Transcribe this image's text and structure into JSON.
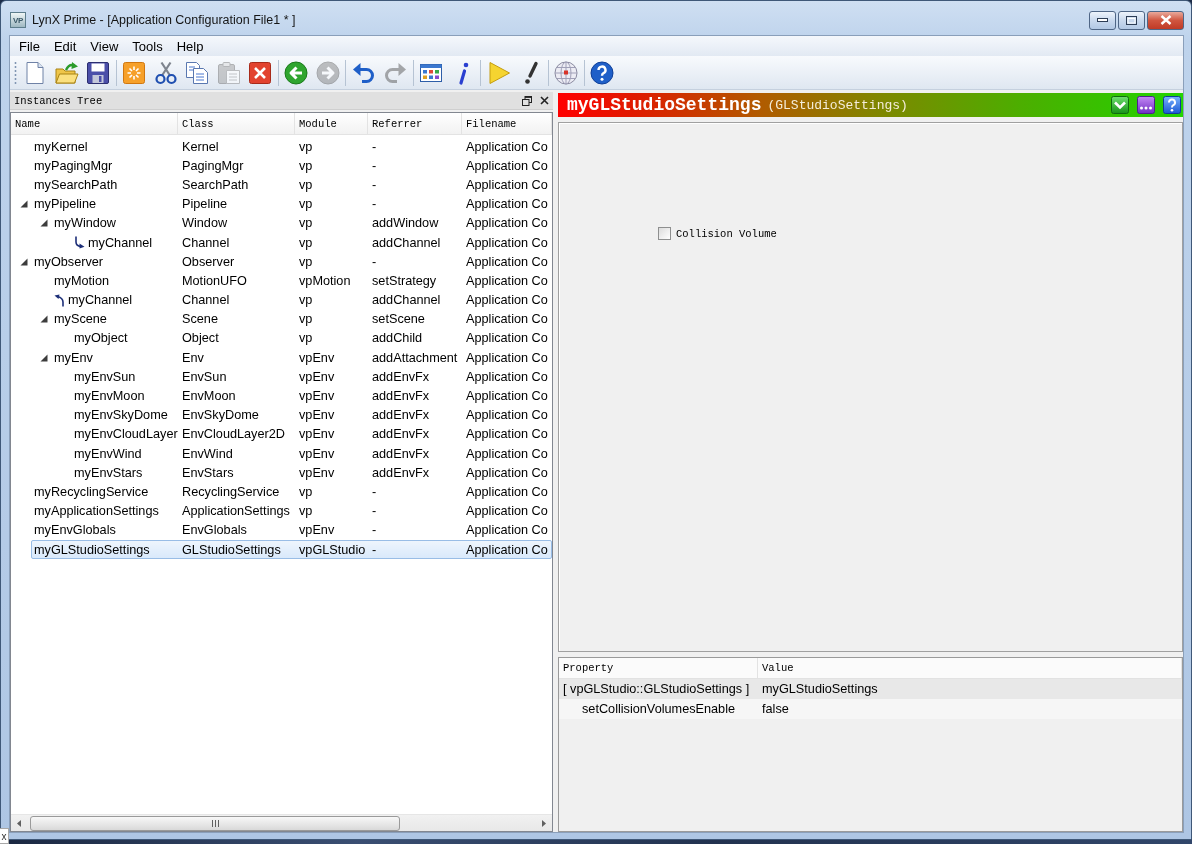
{
  "window": {
    "icon_text": "VP",
    "title": "LynX Prime - [Application Configuration File1 * ]"
  },
  "menu": [
    "File",
    "Edit",
    "View",
    "Tools",
    "Help"
  ],
  "toolbar": {
    "groups": [
      [
        {
          "kind": "new",
          "disabled": false
        },
        {
          "kind": "open",
          "disabled": false
        },
        {
          "kind": "save",
          "disabled": false
        }
      ],
      [
        {
          "kind": "create",
          "disabled": false
        },
        {
          "kind": "cut",
          "disabled": false
        },
        {
          "kind": "copy",
          "disabled": false
        },
        {
          "kind": "paste",
          "disabled": true
        },
        {
          "kind": "delete",
          "disabled": false
        }
      ],
      [
        {
          "kind": "back",
          "disabled": false
        },
        {
          "kind": "forward",
          "disabled": true
        }
      ],
      [
        {
          "kind": "undo",
          "disabled": false
        },
        {
          "kind": "redo",
          "disabled": true
        }
      ],
      [
        {
          "kind": "layout",
          "disabled": false
        },
        {
          "kind": "info",
          "disabled": false
        }
      ],
      [
        {
          "kind": "run",
          "disabled": false
        },
        {
          "kind": "check",
          "disabled": false
        }
      ],
      [
        {
          "kind": "network",
          "disabled": false
        }
      ],
      [
        {
          "kind": "help",
          "disabled": false
        }
      ]
    ]
  },
  "instances_tree": {
    "title": "Instances Tree",
    "columns": [
      "Name",
      "Class",
      "Module",
      "Referrer",
      "Filename"
    ],
    "rows": [
      {
        "kind": "plain",
        "name": "myKernel",
        "class": "Kernel",
        "module": "vp",
        "referrer": "-",
        "filename": "Application Co",
        "selected": false
      },
      {
        "kind": "plain",
        "name": "myPagingMgr",
        "class": "PagingMgr",
        "module": "vp",
        "referrer": "-",
        "filename": "Application Co",
        "selected": false
      },
      {
        "kind": "plain",
        "name": "mySearchPath",
        "class": "SearchPath",
        "module": "vp",
        "referrer": "-",
        "filename": "Application Co",
        "selected": false
      },
      {
        "kind": "plain",
        "name": "myPipeline",
        "class": "Pipeline",
        "module": "vp",
        "referrer": "-",
        "filename": "Application Co",
        "selected": false,
        "expanded": true,
        "children": [
          {
            "kind": "plain",
            "name": "myWindow",
            "class": "Window",
            "module": "vp",
            "referrer": "addWindow",
            "filename": "Application Co",
            "selected": false,
            "expanded": true,
            "children": [
              {
                "kind": "outlink",
                "name": "myChannel",
                "class": "Channel",
                "module": "vp",
                "referrer": "addChannel",
                "filename": "Application Co",
                "selected": false
              }
            ]
          }
        ]
      },
      {
        "kind": "plain",
        "name": "myObserver",
        "class": "Observer",
        "module": "vp",
        "referrer": "-",
        "filename": "Application Co",
        "selected": false,
        "expanded": true,
        "children": [
          {
            "kind": "plain",
            "name": "myMotion",
            "class": "MotionUFO",
            "module": "vpMotion",
            "referrer": "setStrategy",
            "filename": "Application Co",
            "selected": false
          },
          {
            "kind": "inlink",
            "name": "myChannel",
            "class": "Channel",
            "module": "vp",
            "referrer": "addChannel",
            "filename": "Application Co",
            "selected": false
          },
          {
            "kind": "plain",
            "name": "myScene",
            "class": "Scene",
            "module": "vp",
            "referrer": "setScene",
            "filename": "Application Co",
            "selected": false,
            "expanded": true,
            "children": [
              {
                "kind": "plain",
                "name": "myObject",
                "class": "Object",
                "module": "vp",
                "referrer": "addChild",
                "filename": "Application Co",
                "selected": false
              }
            ]
          },
          {
            "kind": "plain",
            "name": "myEnv",
            "class": "Env",
            "module": "vpEnv",
            "referrer": "addAttachment",
            "filename": "Application Co",
            "selected": false,
            "expanded": true,
            "children": [
              {
                "kind": "plain",
                "name": "myEnvSun",
                "class": "EnvSun",
                "module": "vpEnv",
                "referrer": "addEnvFx",
                "filename": "Application Co",
                "selected": false
              },
              {
                "kind": "plain",
                "name": "myEnvMoon",
                "class": "EnvMoon",
                "module": "vpEnv",
                "referrer": "addEnvFx",
                "filename": "Application Co",
                "selected": false
              },
              {
                "kind": "plain",
                "name": "myEnvSkyDome",
                "class": "EnvSkyDome",
                "module": "vpEnv",
                "referrer": "addEnvFx",
                "filename": "Application Co",
                "selected": false
              },
              {
                "kind": "plain",
                "name": "myEnvCloudLayer",
                "class": "EnvCloudLayer2D",
                "module": "vpEnv",
                "referrer": "addEnvFx",
                "filename": "Application Co",
                "selected": false
              },
              {
                "kind": "plain",
                "name": "myEnvWind",
                "class": "EnvWind",
                "module": "vpEnv",
                "referrer": "addEnvFx",
                "filename": "Application Co",
                "selected": false
              },
              {
                "kind": "plain",
                "name": "myEnvStars",
                "class": "EnvStars",
                "module": "vpEnv",
                "referrer": "addEnvFx",
                "filename": "Application Co",
                "selected": false
              }
            ]
          }
        ]
      },
      {
        "kind": "plain",
        "name": "myRecyclingService",
        "class": "RecyclingService",
        "module": "vp",
        "referrer": "-",
        "filename": "Application Co",
        "selected": false
      },
      {
        "kind": "plain",
        "name": "myApplicationSettings",
        "class": "ApplicationSettings",
        "module": "vp",
        "referrer": "-",
        "filename": "Application Co",
        "selected": false
      },
      {
        "kind": "plain",
        "name": "myEnvGlobals",
        "class": "EnvGlobals",
        "module": "vpEnv",
        "referrer": "-",
        "filename": "Application Co",
        "selected": false
      },
      {
        "kind": "plain",
        "name": "myGLStudioSettings",
        "class": "GLStudioSettings",
        "module": "vpGLStudio",
        "referrer": "-",
        "filename": "Application Co",
        "selected": true
      }
    ]
  },
  "inspector": {
    "name": "myGLStudioSettings",
    "class_label": "(GLStudioSettings)",
    "checkbox": {
      "label": "Collision Volume",
      "checked": false
    },
    "properties": {
      "columns": [
        "Property",
        "Value"
      ],
      "rows": [
        {
          "property": "[ vpGLStudio::GLStudioSettings ]",
          "value": "myGLStudioSettings",
          "children": [
            {
              "property": "setCollisionVolumesEnable",
              "value": "false"
            }
          ]
        }
      ]
    }
  },
  "corner_fragment": "x"
}
